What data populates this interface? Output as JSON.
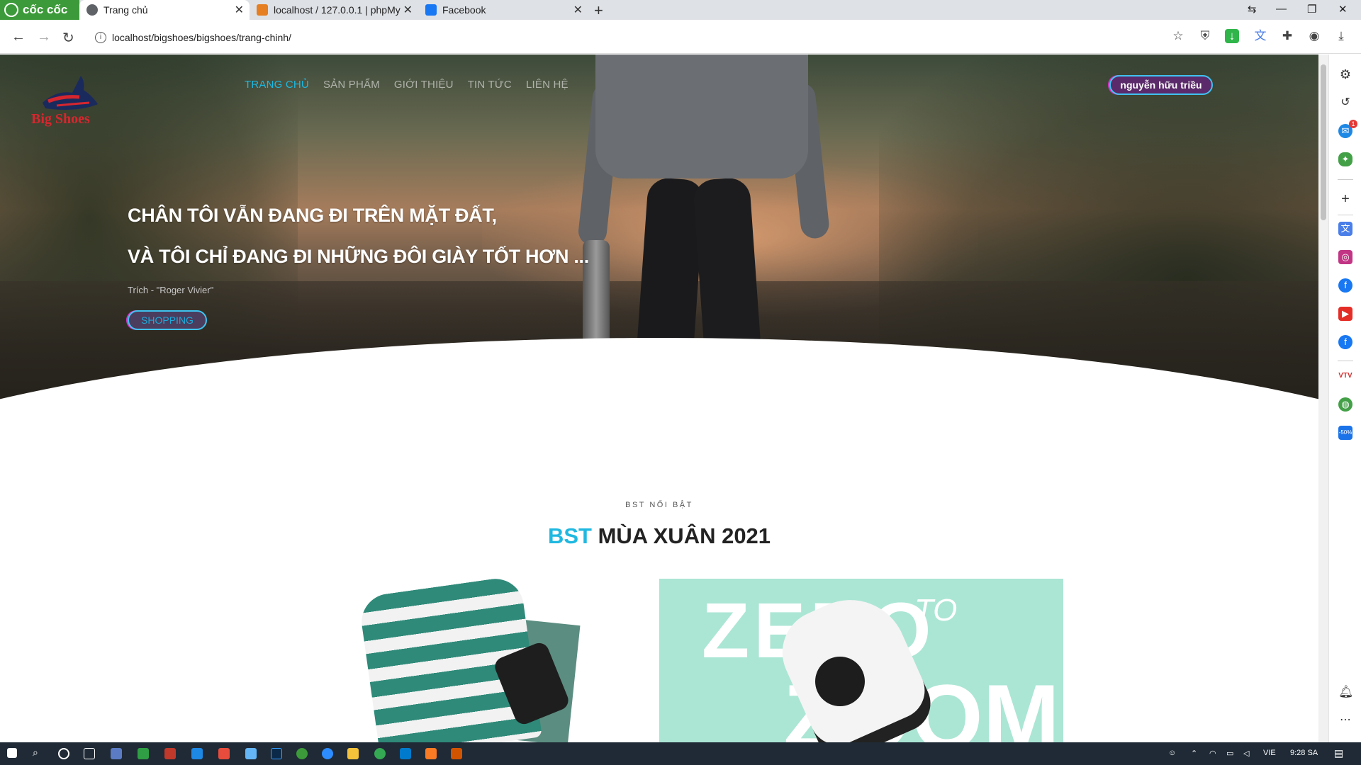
{
  "browser": {
    "brand": "cốc cốc",
    "tabs": [
      {
        "title": "Trang chủ",
        "favicon_color": "#5f6368"
      },
      {
        "title": "localhost / 127.0.0.1 | phpMy",
        "favicon_color": "#e67e22"
      },
      {
        "title": "Facebook",
        "favicon_color": "#1877f2"
      }
    ],
    "url": "localhost/bigshoes/bigshoes/trang-chinh/"
  },
  "site": {
    "logo_text": "Big Shoes",
    "nav": [
      "TRANG CHỦ",
      "SẢN PHẨM",
      "GIỚI THIỆU",
      "TIN TỨC",
      "LIÊN HỆ"
    ],
    "user_name": "nguyễn hữu triều",
    "hero": {
      "line1": "CHÂN TÔI VẪN ĐANG ĐI TRÊN MẶT ĐẤT,",
      "line2": "VÀ TÔI CHỈ ĐANG ĐI NHỮNG ĐÔI GIÀY TỐT HƠN ...",
      "citation": "Trích - \"Roger Vivier\"",
      "button": "SHOPPING"
    },
    "collection": {
      "subtitle": "BST NỔI BẬT",
      "title_highlight": "BST",
      "title_rest": " MÙA XUÂN 2021"
    },
    "promo": {
      "word1": "ZERO",
      "word2": "TO",
      "word3": "ZOOM"
    }
  },
  "sidebar_icons": [
    "gear-icon",
    "history-icon",
    "messenger-icon",
    "game-icon",
    "plus-icon",
    "translate-icon",
    "instagram-icon",
    "facebook-icon",
    "youtube-icon",
    "facebook-icon",
    "vtv-icon",
    "chrome-icon",
    "tiki-icon",
    "bell-icon",
    "more-icon"
  ],
  "sidebar_badge": "1",
  "tiki_badge": "-50%",
  "taskbar": {
    "language": "VIE",
    "time": "9:28 SA"
  },
  "colors": {
    "accent": "#1fb8e0",
    "brand_red": "#d7262e",
    "browser_green": "#3d9a3a"
  }
}
